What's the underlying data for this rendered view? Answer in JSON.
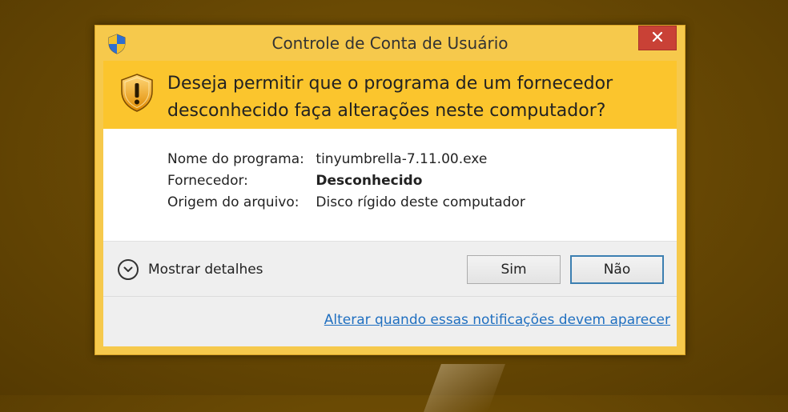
{
  "window": {
    "title": "Controle de Conta de Usuário",
    "question_line1": "Deseja permitir que o programa de um fornecedor",
    "question_line2": "desconhecido faça alterações neste computador?"
  },
  "details": [
    {
      "label": "Nome do programa:",
      "value": "tinyumbrella-7.11.00.exe"
    },
    {
      "label": "Fornecedor:",
      "value": "Desconhecido"
    },
    {
      "label": "Origem do arquivo:",
      "value": "Disco rígido deste computador"
    }
  ],
  "actions": {
    "show_details": "Mostrar detalhes",
    "yes": "Sim",
    "no": "Não"
  },
  "footer": {
    "link": "Alterar quando essas notificações devem aparecer"
  },
  "colors": {
    "frame": "#f6c94c",
    "header_band": "#fbc52d",
    "close_button": "#c94136",
    "link": "#1f6fc0",
    "default_button_border": "#3c7fb1"
  },
  "icons": [
    "uac-shield-icon",
    "close-icon",
    "warning-shield-icon",
    "chevron-down-icon"
  ]
}
